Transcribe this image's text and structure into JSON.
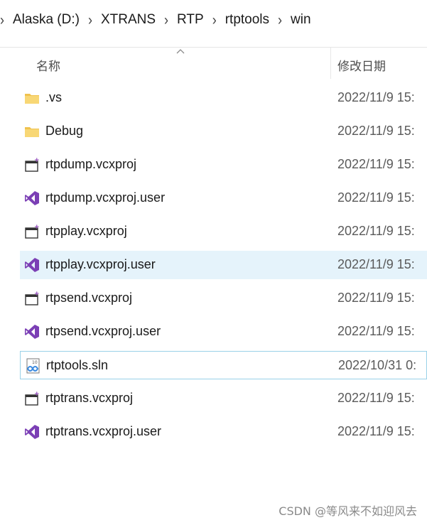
{
  "breadcrumb": [
    "Alaska (D:)",
    "XTRANS",
    "RTP",
    "rtptools",
    "win"
  ],
  "columns": {
    "name": "名称",
    "date": "修改日期"
  },
  "files": [
    {
      "name": ".vs",
      "date": "2022/11/9 15:",
      "icon": "folder-icon"
    },
    {
      "name": "Debug",
      "date": "2022/11/9 15:",
      "icon": "folder-icon"
    },
    {
      "name": "rtpdump.vcxproj",
      "date": "2022/11/9 15:",
      "icon": "vcxproj-icon"
    },
    {
      "name": "rtpdump.vcxproj.user",
      "date": "2022/11/9 15:",
      "icon": "visual-studio-icon"
    },
    {
      "name": "rtpplay.vcxproj",
      "date": "2022/11/9 15:",
      "icon": "vcxproj-icon"
    },
    {
      "name": "rtpplay.vcxproj.user",
      "date": "2022/11/9 15:",
      "icon": "visual-studio-icon"
    },
    {
      "name": "rtpsend.vcxproj",
      "date": "2022/11/9 15:",
      "icon": "vcxproj-icon"
    },
    {
      "name": "rtpsend.vcxproj.user",
      "date": "2022/11/9 15:",
      "icon": "visual-studio-icon"
    },
    {
      "name": "rtptools.sln",
      "date": "2022/10/31 0:",
      "icon": "sln-icon"
    },
    {
      "name": "rtptrans.vcxproj",
      "date": "2022/11/9 15:",
      "icon": "vcxproj-icon"
    },
    {
      "name": "rtptrans.vcxproj.user",
      "date": "2022/11/9 15:",
      "icon": "visual-studio-icon"
    }
  ],
  "selected_index": 5,
  "focused_index": 8,
  "watermark": "CSDN @等风来不如迎风去",
  "colors": {
    "selected_bg": "#e5f3fb",
    "focus_border": "#99d1e8",
    "folder": "#f8d775",
    "vs_purple": "#68217a"
  }
}
